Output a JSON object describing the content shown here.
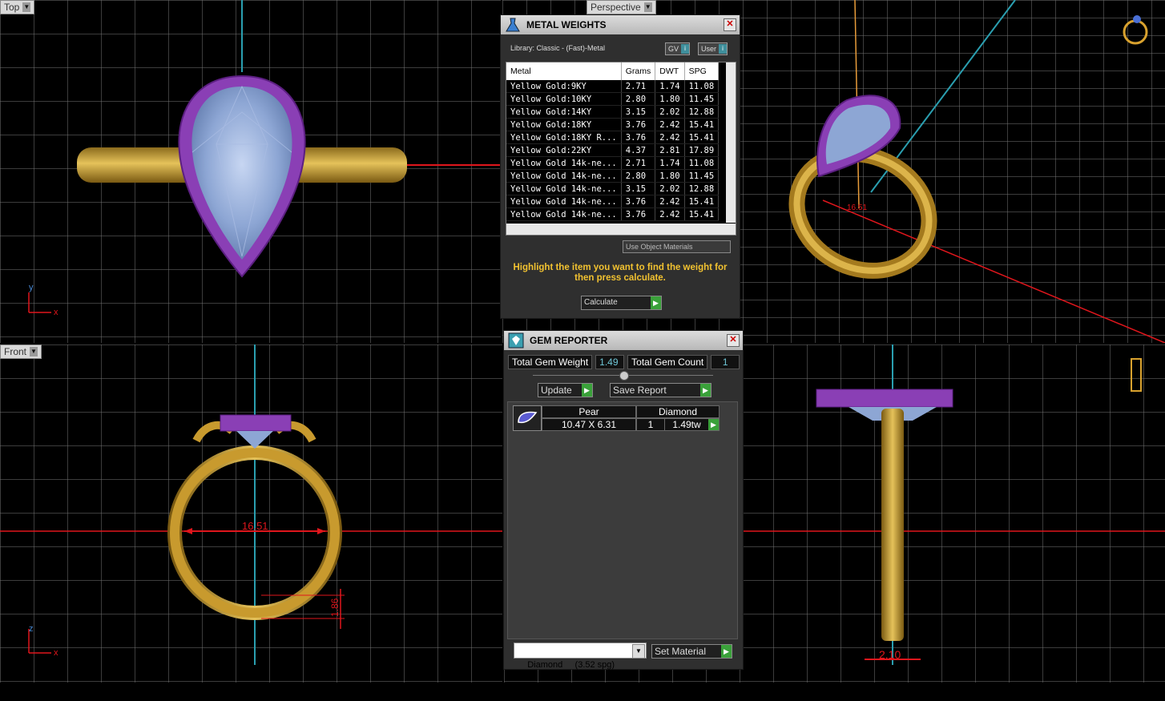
{
  "viewports": {
    "top": {
      "label": "Top",
      "axis_x": "x",
      "axis_y": "y"
    },
    "perspective": {
      "label": "Perspective"
    },
    "front": {
      "label": "Front",
      "axis_x": "x",
      "axis_y": "z",
      "dim_width": "16.51",
      "dim_thickness": "1.86"
    },
    "side": {
      "dim_width": "2.10"
    }
  },
  "metal_weights": {
    "title": "METAL WEIGHTS",
    "library": "Library: Classic - (Fast)-Metal",
    "toggle_gv": "GV",
    "toggle_user": "User",
    "columns": [
      "Metal",
      "Grams",
      "DWT",
      "SPG"
    ],
    "rows": [
      [
        "Yellow Gold:9KY",
        "2.71",
        "1.74",
        "11.08"
      ],
      [
        "Yellow Gold:10KY",
        "2.80",
        "1.80",
        "11.45"
      ],
      [
        "Yellow Gold:14KY",
        "3.15",
        "2.02",
        "12.88"
      ],
      [
        "Yellow Gold:18KY",
        "3.76",
        "2.42",
        "15.41"
      ],
      [
        "Yellow Gold:18KY R...",
        "3.76",
        "2.42",
        "15.41"
      ],
      [
        "Yellow Gold:22KY",
        "4.37",
        "2.81",
        "17.89"
      ],
      [
        "Yellow Gold 14k-ne...",
        "2.71",
        "1.74",
        "11.08"
      ],
      [
        "Yellow Gold 14k-ne...",
        "2.80",
        "1.80",
        "11.45"
      ],
      [
        "Yellow Gold 14k-ne...",
        "3.15",
        "2.02",
        "12.88"
      ],
      [
        "Yellow Gold 14k-ne...",
        "3.76",
        "2.42",
        "15.41"
      ],
      [
        "Yellow Gold 14k-ne...",
        "3.76",
        "2.42",
        "15.41"
      ]
    ],
    "use_object_materials": "Use Object Materials",
    "hint": "Highlight the item you want to find the weight for then press calculate.",
    "calculate": "Calculate"
  },
  "gem_reporter": {
    "title": "GEM REPORTER",
    "total_weight_label": "Total Gem Weight",
    "total_weight": "1.49",
    "total_count_label": "Total Gem Count",
    "total_count": "1",
    "update": "Update",
    "save_report": "Save Report",
    "gem": {
      "shape": "Pear",
      "material": "Diamond",
      "size": "10.47 X 6.31",
      "count": "1",
      "weight": "1.49tw"
    },
    "material_select": "Diamond     (3.52 spg)",
    "set_material": "Set Material"
  },
  "colors": {
    "gold": "#c89a2e",
    "purple": "#8a3fb5",
    "stone": "#8fa8d6",
    "dimension": "#e0161c",
    "axis": "#2a9fb0"
  }
}
